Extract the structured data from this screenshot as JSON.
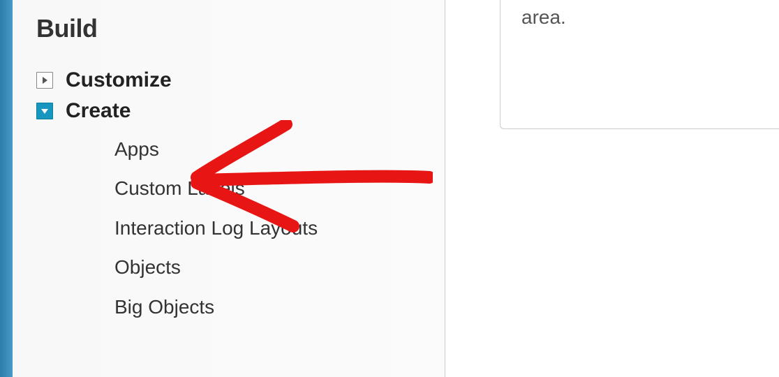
{
  "sidebar": {
    "title": "Build",
    "items": [
      {
        "label": "Customize",
        "expanded": false
      },
      {
        "label": "Create",
        "expanded": true
      }
    ],
    "create_subitems": [
      {
        "label": "Apps"
      },
      {
        "label": "Custom Labels"
      },
      {
        "label": "Interaction Log Layouts"
      },
      {
        "label": "Objects"
      },
      {
        "label": "Big Objects"
      }
    ]
  },
  "card": {
    "text": "area."
  }
}
